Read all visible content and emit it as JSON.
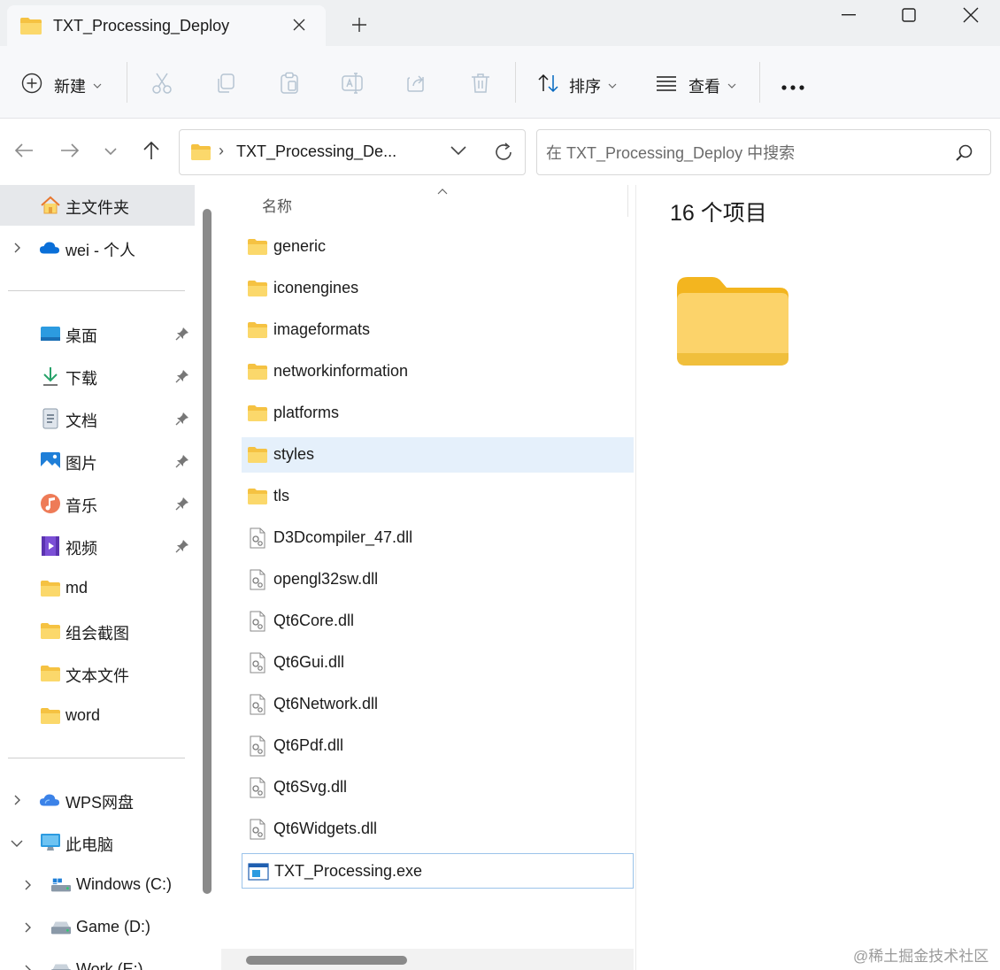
{
  "window": {
    "tab_title": "TXT_Processing_Deploy",
    "tab_close_icon": "close-icon",
    "new_tab_symbol": "+"
  },
  "toolbar": {
    "new_label": "新建",
    "sort_label": "排序",
    "view_label": "查看",
    "more_label": "..."
  },
  "address": {
    "path_text": "TXT_Processing_De...",
    "search_placeholder": "在 TXT_Processing_Deploy 中搜索"
  },
  "sidebar": {
    "home": "主文件夹",
    "onedrive": "wei - 个人",
    "quick": [
      {
        "label": "桌面",
        "icon": "desktop-icon"
      },
      {
        "label": "下载",
        "icon": "download-icon"
      },
      {
        "label": "文档",
        "icon": "document-icon"
      },
      {
        "label": "图片",
        "icon": "pictures-icon"
      },
      {
        "label": "音乐",
        "icon": "music-icon"
      },
      {
        "label": "视频",
        "icon": "video-icon"
      },
      {
        "label": "md",
        "icon": "folder-icon"
      },
      {
        "label": "组会截图",
        "icon": "folder-icon"
      },
      {
        "label": "文本文件",
        "icon": "folder-icon"
      },
      {
        "label": "word",
        "icon": "folder-icon"
      }
    ],
    "wps": "WPS网盘",
    "this_pc": "此电脑",
    "drives": [
      "Windows (C:)",
      "Game (D:)",
      "Work (E:)"
    ]
  },
  "filelist": {
    "column_name": "名称",
    "items": [
      {
        "name": "generic",
        "type": "folder"
      },
      {
        "name": "iconengines",
        "type": "folder"
      },
      {
        "name": "imageformats",
        "type": "folder"
      },
      {
        "name": "networkinformation",
        "type": "folder"
      },
      {
        "name": "platforms",
        "type": "folder"
      },
      {
        "name": "styles",
        "type": "folder"
      },
      {
        "name": "tls",
        "type": "folder"
      },
      {
        "name": "D3Dcompiler_47.dll",
        "type": "dll"
      },
      {
        "name": "opengl32sw.dll",
        "type": "dll"
      },
      {
        "name": "Qt6Core.dll",
        "type": "dll"
      },
      {
        "name": "Qt6Gui.dll",
        "type": "dll"
      },
      {
        "name": "Qt6Network.dll",
        "type": "dll"
      },
      {
        "name": "Qt6Pdf.dll",
        "type": "dll"
      },
      {
        "name": "Qt6Svg.dll",
        "type": "dll"
      },
      {
        "name": "Qt6Widgets.dll",
        "type": "dll"
      },
      {
        "name": "TXT_Processing.exe",
        "type": "exe"
      }
    ],
    "hovered_item": "styles",
    "focused_item": "TXT_Processing.exe"
  },
  "preview": {
    "item_count": "16 个项目"
  },
  "watermark": "@稀土掘金技术社区",
  "colors": {
    "folder_yellow": "#f5c242",
    "accent_blue": "#0067c0",
    "hover_row": "#e5f0fb",
    "selected_nav": "#e6e8eb"
  }
}
